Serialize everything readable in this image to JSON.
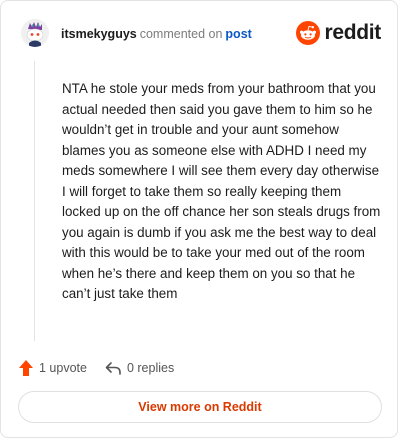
{
  "header": {
    "username": "itsmekyguys",
    "action_text": "commented on",
    "post_link": "post",
    "logo_text": "reddit"
  },
  "comment": {
    "body": "NTA he stole your meds from your bathroom that you actual needed then said you gave them to him so he wouldn’t get in trouble and your aunt somehow blames you as someone else with ADHD I need my meds somewhere I will see them every day otherwise I will forget to take them so really keeping them locked up on the off chance her son steals drugs from you again is dumb if you ask me the best way to deal with this would be to take your med out of the room when he’s there and keep them on you so that he can’t just take them"
  },
  "actions": {
    "upvote_label": "1 upvote",
    "replies_label": "0 replies"
  },
  "footer": {
    "view_more_label": "View more on Reddit"
  },
  "colors": {
    "brand": "#ff4500",
    "link": "#0b59c5",
    "view_more": "#d93a00"
  },
  "icons": {
    "avatar": "snoo-avatar",
    "logo": "reddit-snoo-icon",
    "upvote": "upvote-arrow-icon",
    "reply": "reply-arrow-icon"
  }
}
